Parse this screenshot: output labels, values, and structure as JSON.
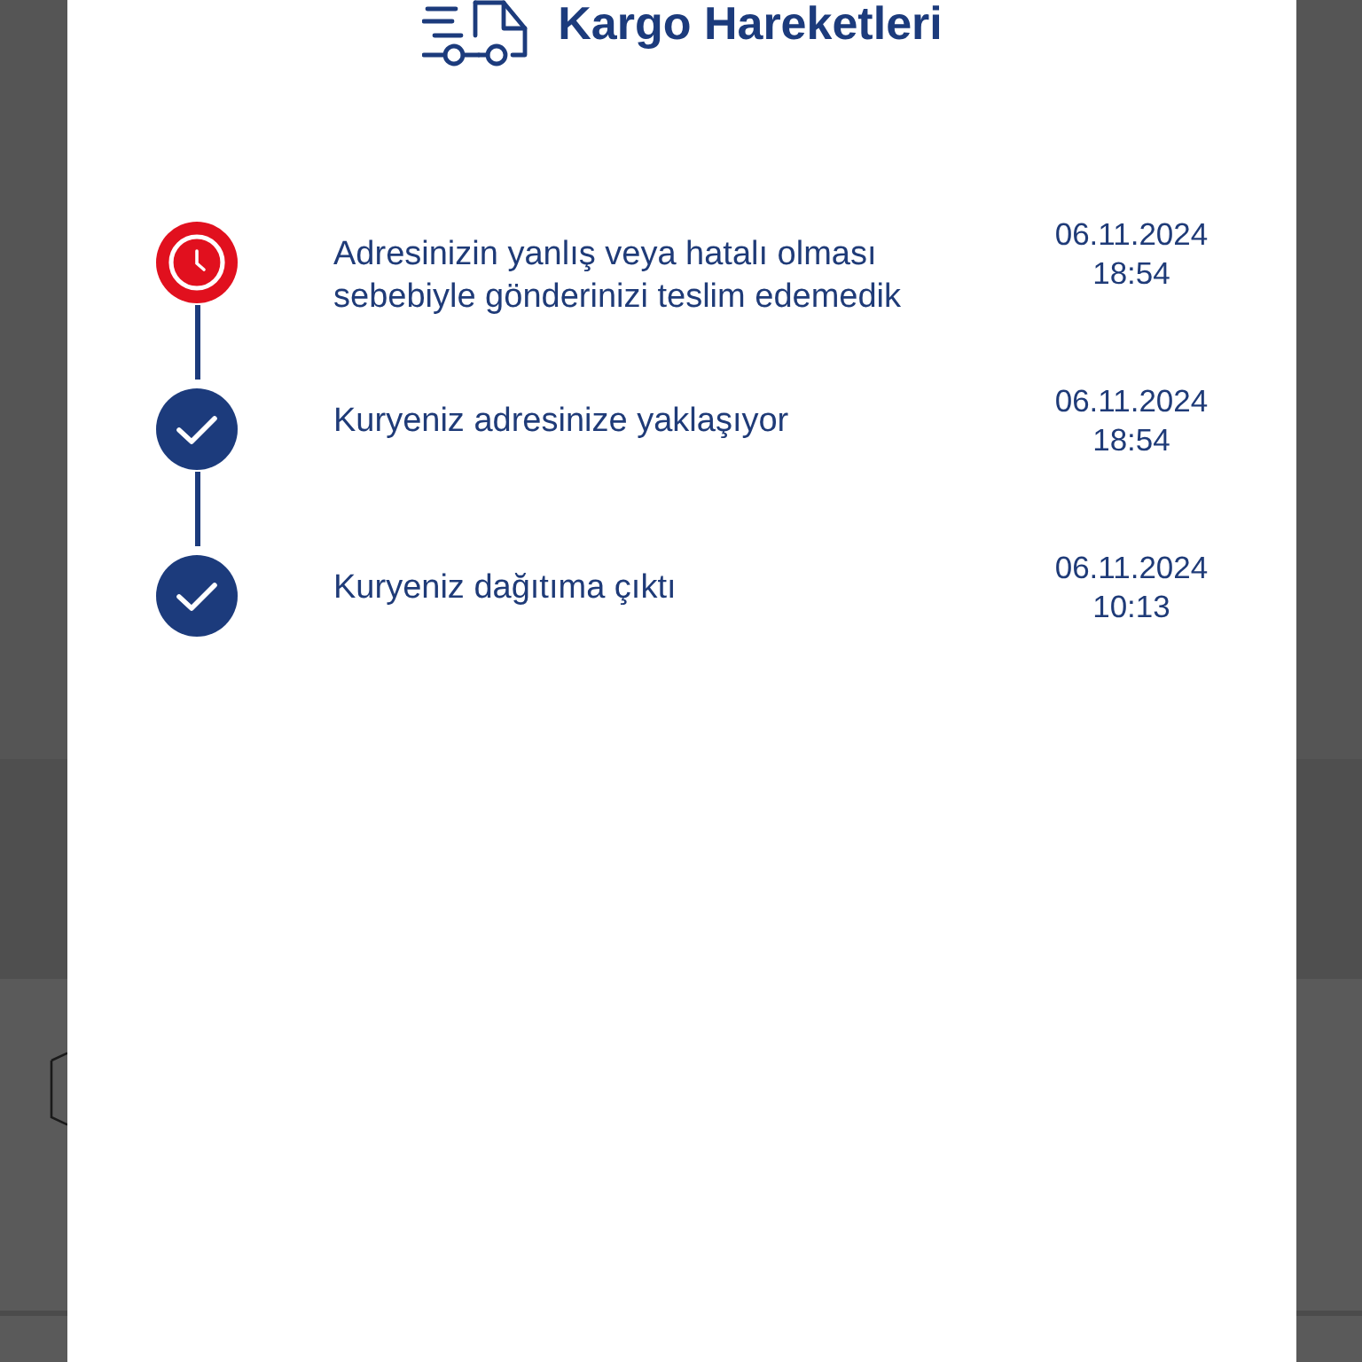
{
  "dialog": {
    "title": "Kargo Hareketleri"
  },
  "timeline": [
    {
      "kind": "failed",
      "text": "Adresinizin yanlış veya hatalı olması sebebiyle gönderinizi teslim edemedik",
      "date": "06.11.2024",
      "time": "18:54"
    },
    {
      "kind": "done",
      "text": "Kuryeniz adresinize yaklaşıyor",
      "date": "06.11.2024",
      "time": "18:54"
    },
    {
      "kind": "done",
      "text": "Kuryeniz dağıtıma çıktı",
      "date": "06.11.2024",
      "time": "10:13"
    }
  ]
}
